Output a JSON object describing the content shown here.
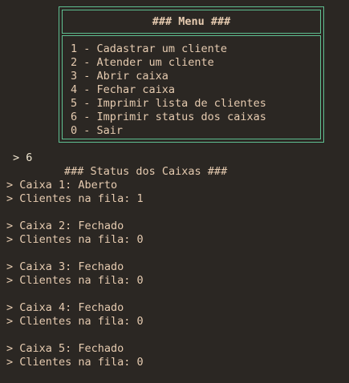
{
  "menu": {
    "title": "### Menu ###",
    "items": [
      "1 - Cadastrar um cliente",
      "2 - Atender um cliente",
      "3 - Abrir caixa",
      "4 - Fechar caixa",
      "5 - Imprimir lista de clientes",
      "6 - Imprimir status dos caixas",
      "0 - Sair"
    ]
  },
  "prompt": {
    "text": "> 6"
  },
  "status": {
    "title": "### Status dos Caixas ###",
    "caixas": [
      {
        "status_line": "> Caixa 1: Aberto",
        "queue_line": "> Clientes na fila: 1"
      },
      {
        "status_line": "> Caixa 2: Fechado",
        "queue_line": "> Clientes na fila: 0"
      },
      {
        "status_line": "> Caixa 3: Fechado",
        "queue_line": "> Clientes na fila: 0"
      },
      {
        "status_line": "> Caixa 4: Fechado",
        "queue_line": "> Clientes na fila: 0"
      },
      {
        "status_line": "> Caixa 5: Fechado",
        "queue_line": "> Clientes na fila: 0"
      }
    ]
  },
  "colors": {
    "background": "#2b2723",
    "text": "#e6cbb0",
    "border": "#5fbf91"
  }
}
